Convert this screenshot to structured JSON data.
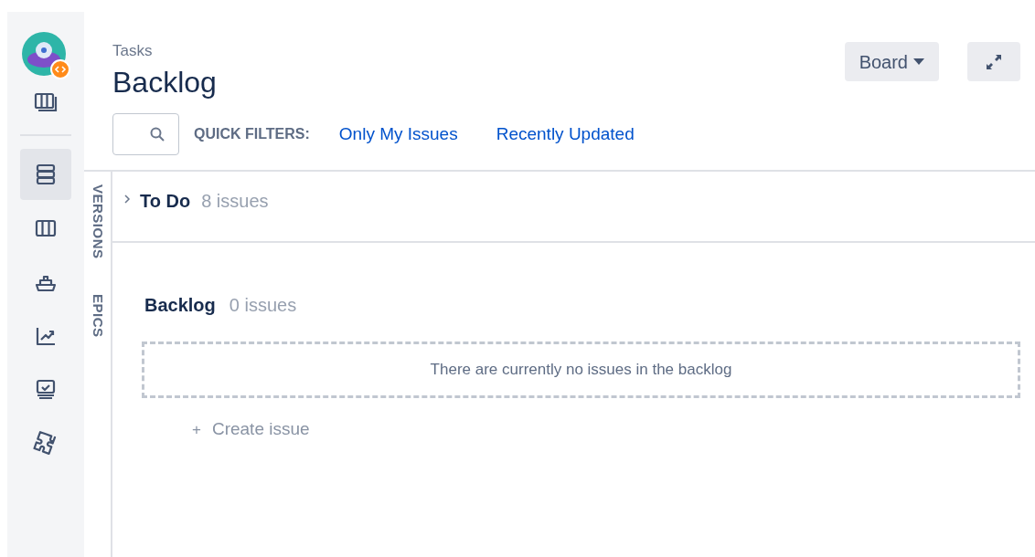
{
  "sidebar": {
    "items": [
      {
        "selected": true
      },
      {
        "selected": false
      },
      {
        "selected": false
      },
      {
        "selected": false
      },
      {
        "selected": false
      },
      {
        "selected": false
      }
    ]
  },
  "header": {
    "breadcrumb": "Tasks",
    "title": "Backlog",
    "board_button": "Board"
  },
  "quick_filters": {
    "label": "QUICK FILTERS:",
    "links": [
      "Only My Issues",
      "Recently Updated"
    ]
  },
  "side_tabs": [
    "VERSIONS",
    "EPICS"
  ],
  "sprint": {
    "name": "To Do",
    "count": "8 issues",
    "expanded": false
  },
  "backlog": {
    "name": "Backlog",
    "count": "0 issues",
    "empty_message": "There are currently no issues in the backlog",
    "create": "Create issue",
    "create_icon": "+"
  }
}
